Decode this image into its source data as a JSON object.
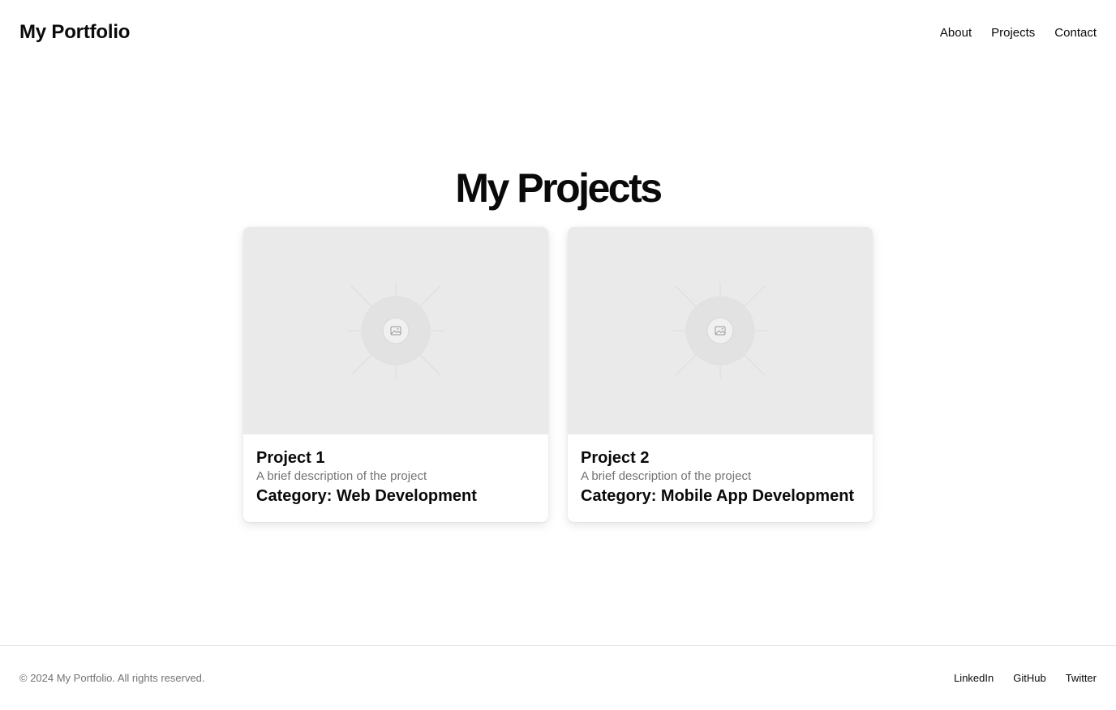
{
  "header": {
    "brand": "My Portfolio",
    "nav": [
      {
        "label": "About"
      },
      {
        "label": "Projects"
      },
      {
        "label": "Contact"
      }
    ]
  },
  "main": {
    "title": "My Projects",
    "projects": [
      {
        "title": "Project 1",
        "description": "A brief description of the project",
        "category": "Category: Web Development",
        "image_icon": "image-placeholder-icon"
      },
      {
        "title": "Project 2",
        "description": "A brief description of the project",
        "category": "Category: Mobile App Development",
        "image_icon": "image-placeholder-icon"
      }
    ]
  },
  "footer": {
    "copyright": "© 2024 My Portfolio. All rights reserved.",
    "links": [
      {
        "label": "LinkedIn"
      },
      {
        "label": "GitHub"
      },
      {
        "label": "Twitter"
      }
    ]
  },
  "colors": {
    "text": "#0a0a0a",
    "muted": "#737373",
    "image_bg": "#eaeaea",
    "border": "#e5e5e5"
  }
}
